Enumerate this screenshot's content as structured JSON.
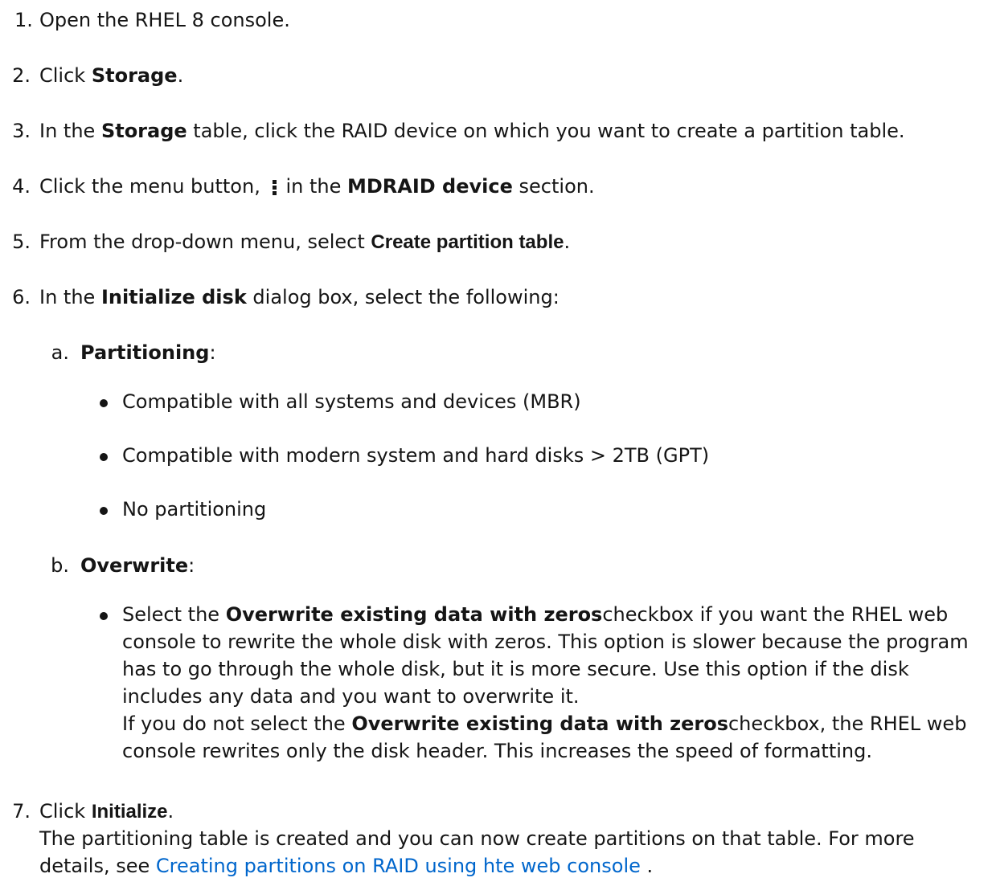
{
  "steps": {
    "s1": {
      "num": "1.",
      "text": "Open the RHEL 8 console."
    },
    "s2": {
      "num": "2.",
      "pre": "Click ",
      "bold": "Storage",
      "post": "."
    },
    "s3": {
      "num": "3.",
      "pre": "In the ",
      "bold": "Storage",
      "post": " table, click the RAID device on which you want to create a partition table."
    },
    "s4": {
      "num": "4.",
      "pre": "Click the menu button, ",
      "icon": "kebab-menu-icon",
      "mid": "in the ",
      "bold": "MDRAID device",
      "post": " section."
    },
    "s5": {
      "num": "5.",
      "pre": "From the drop-down menu, select ",
      "bold": "Create partition table",
      "post": "."
    },
    "s6": {
      "num": "6.",
      "pre": "In the ",
      "bold": "Initialize disk",
      "post": " dialog box, select the following:"
    },
    "s6a": {
      "num": "a.",
      "bold": "Partitioning",
      "post": ":"
    },
    "s6a_options": [
      "Compatible with all systems and devices (MBR)",
      "Compatible with modern system and hard disks > 2TB (GPT)",
      "No partitioning"
    ],
    "s6b": {
      "num": "b.",
      "bold": "Overwrite",
      "post": ":"
    },
    "s6b_option": {
      "l1_pre": "Select the ",
      "l1_bold": "Overwrite existing data with zeros",
      "l1_post": "checkbox if you want the RHEL web",
      "l2": "console to rewrite the whole disk with zeros. This option is slower because the program",
      "l3": "has to go through the whole disk, but it is more secure. Use this option if the disk",
      "l4": "includes any data and you want to overwrite it.",
      "l5_pre": "If you do not select the ",
      "l5_bold": "Overwrite existing data with zeros",
      "l5_post": "checkbox, the RHEL web",
      "l6": "console rewrites only the disk header. This increases the speed of formatting."
    },
    "s7": {
      "num": "7.",
      "pre": "Click ",
      "bold": "Initialize",
      "post": ".",
      "l2": "The partitioning table is created and you can now create partitions on that table. For more",
      "l3_pre": "details, see ",
      "link": "Creating partitions on RAID using hte web console",
      "l3_post": " ."
    }
  },
  "colors": {
    "text": "#151515",
    "link": "#0066cc",
    "background": "#ffffff"
  }
}
